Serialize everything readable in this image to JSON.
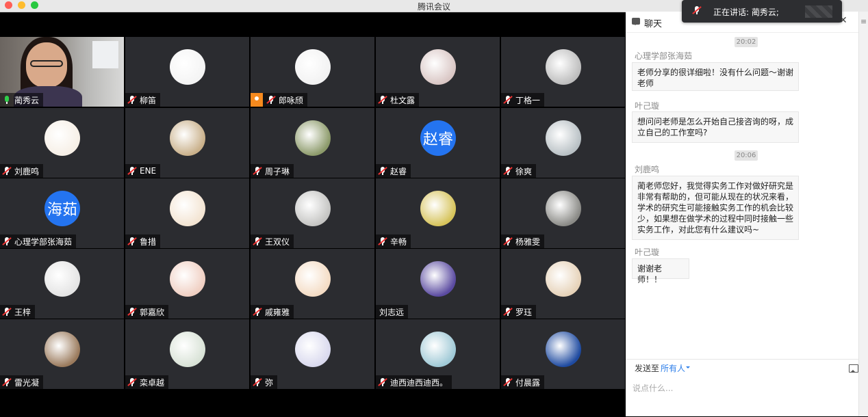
{
  "window": {
    "title": "腾讯会议"
  },
  "participants": [
    {
      "name": "蔺秀云",
      "mic": "on",
      "video": true,
      "cam_badge": false
    },
    {
      "name": "柳笛",
      "mic": "muted",
      "avatar_color": "#f4f4f4"
    },
    {
      "name": "郎咏颀",
      "mic": "muted",
      "cam_badge": true,
      "avatar_color": "#f2f2f2"
    },
    {
      "name": "杜文露",
      "mic": "muted",
      "avatar_color": "#d9c6c4"
    },
    {
      "name": "丁格一",
      "mic": "muted",
      "avatar_color": "#bdbdbd"
    },
    {
      "name": "刘鹿鸣",
      "mic": "muted",
      "avatar_color": "#f6efe6"
    },
    {
      "name": "ENE",
      "mic": "muted",
      "avatar_color": "#c9b08a"
    },
    {
      "name": "周子琳",
      "mic": "muted",
      "avatar_color": "#8c9a6a"
    },
    {
      "name": "赵睿",
      "mic": "muted",
      "avatar_text": "赵睿",
      "avatar_color": "#2474f0"
    },
    {
      "name": "徐爽",
      "mic": "muted",
      "avatar_color": "#b8c0c4"
    },
    {
      "name": "心理学部张海茹",
      "mic": "muted",
      "avatar_text": "海茹",
      "avatar_color": "#2474f0"
    },
    {
      "name": "鲁措",
      "mic": "muted",
      "avatar_color": "#f3e4d2"
    },
    {
      "name": "王双仪",
      "mic": "muted",
      "avatar_color": "#c4c4c2"
    },
    {
      "name": "辛畅",
      "mic": "muted",
      "avatar_color": "#d6c35a"
    },
    {
      "name": "杨雅雯",
      "mic": "muted",
      "avatar_color": "#8a8a86"
    },
    {
      "name": "王梓",
      "mic": "muted",
      "avatar_color": "#e4e4e4"
    },
    {
      "name": "郭嘉欣",
      "mic": "muted",
      "avatar_color": "#f0cfc2"
    },
    {
      "name": "戚雍雅",
      "mic": "muted",
      "avatar_color": "#f4dcc4"
    },
    {
      "name": "刘志远",
      "mic": "none",
      "avatar_color": "#5a4aa0"
    },
    {
      "name": "罗珏",
      "mic": "muted",
      "avatar_color": "#e6d2b8"
    },
    {
      "name": "雷光凝",
      "mic": "muted",
      "avatar_color": "#9a7a5c"
    },
    {
      "name": "栾卓越",
      "mic": "muted",
      "avatar_color": "#d8e2d6"
    },
    {
      "name": "弥",
      "mic": "muted",
      "avatar_color": "#d9d9ee"
    },
    {
      "name": "迪西迪西迪西。",
      "mic": "muted",
      "avatar_color": "#9fc9d6"
    },
    {
      "name": "付晨露",
      "mic": "muted",
      "avatar_color": "#1e4aa0"
    }
  ],
  "chat": {
    "title": "聊天",
    "messages": [
      {
        "type": "time",
        "text": "20:02"
      },
      {
        "type": "msg",
        "sender": "心理学部张海茹",
        "text": "老师分享的很详细啦！没有什么问题～谢谢老师"
      },
      {
        "type": "msg",
        "sender": "叶己璇",
        "text": "想问问老师是怎么开始自己接咨询的呀，成立自己的工作室吗?"
      },
      {
        "type": "time",
        "text": "20:06"
      },
      {
        "type": "msg",
        "sender": "刘鹿鸣",
        "text": "蔺老师您好，我觉得实务工作对做好研究是非常有帮助的，但可能从现在的状况来看，学术的研究生可能接触实务工作的机会比较少，如果想在做学术的过程中同时接触一些实务工作，对此您有什么建议吗~"
      },
      {
        "type": "msg",
        "sender": "叶己璇",
        "text": "谢谢老师！！"
      }
    ],
    "send_to_label": "发送至",
    "send_to_target": "所有人",
    "input_placeholder": "说点什么..."
  },
  "toast": {
    "speaking_label": "正在讲话: 蔺秀云;"
  }
}
